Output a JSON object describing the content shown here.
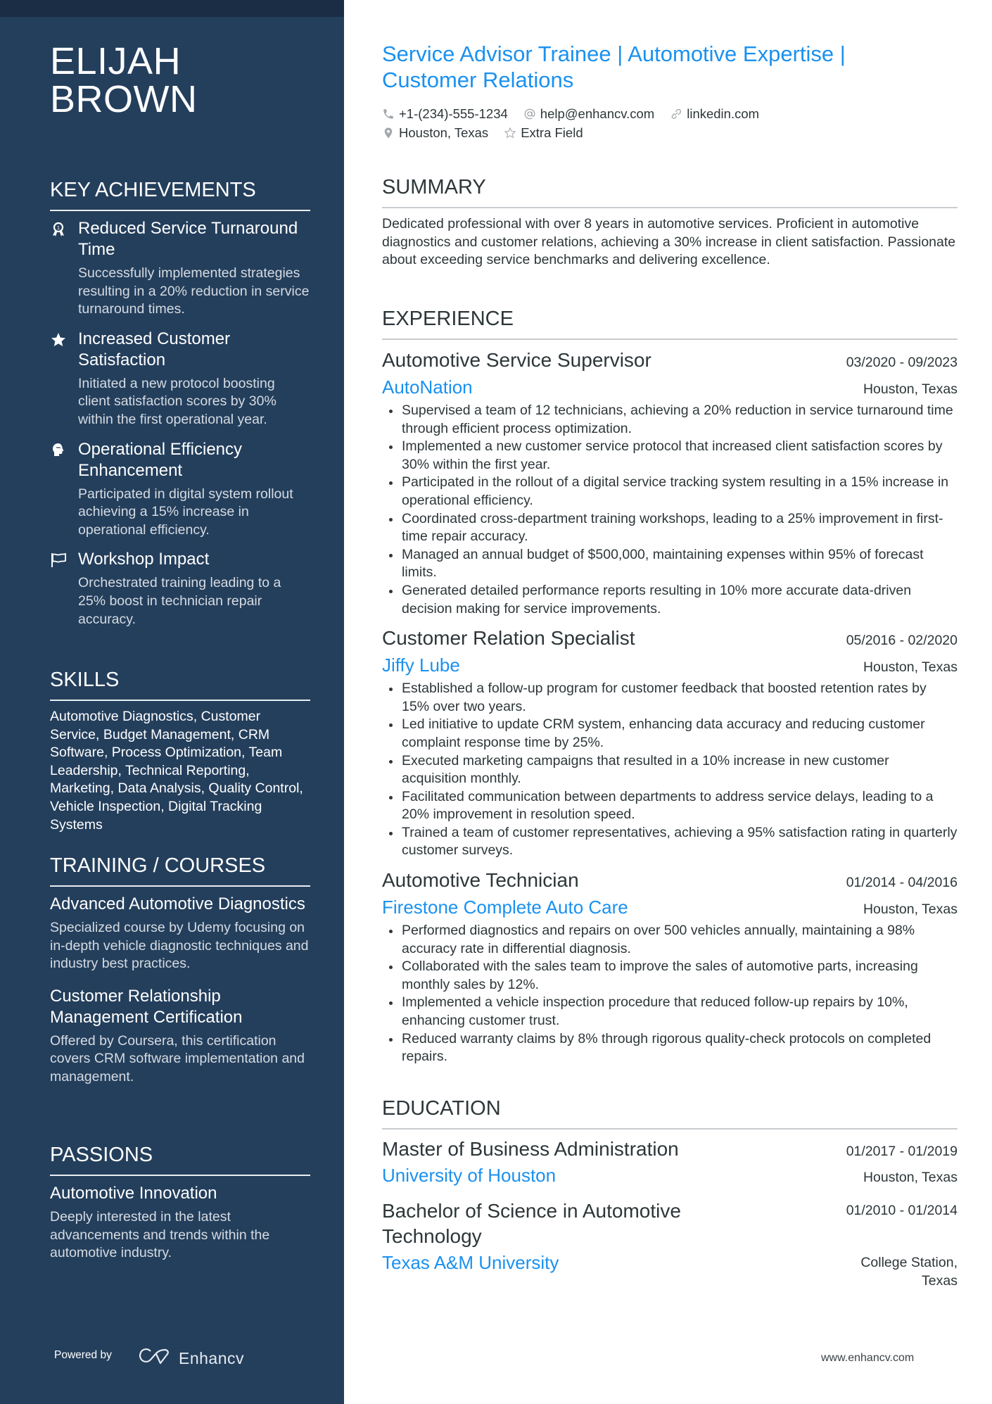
{
  "profile": {
    "first_name": "ELIJAH",
    "last_name": "BROWN",
    "headline": "Service Advisor Trainee | Automotive Expertise | Customer Relations",
    "contacts": {
      "phone": "+1-(234)-555-1234",
      "email": "help@enhancv.com",
      "linkedin": "linkedin.com",
      "location": "Houston, Texas",
      "extra": "Extra Field"
    }
  },
  "colors": {
    "sidebar": "#243f5c",
    "sidebar_strip": "#1b2d45",
    "accent": "#1a91f0",
    "text": "#2d3639"
  },
  "sidebar": {
    "achievements": {
      "heading": "KEY ACHIEVEMENTS",
      "items": [
        {
          "icon": "award-ribbon-icon",
          "title": "Reduced Service Turnaround Time",
          "desc": "Successfully implemented strategies resulting in a 20% reduction in service turnaround times."
        },
        {
          "icon": "star-icon",
          "title": "Increased Customer Satisfaction",
          "desc": "Initiated a new protocol boosting client satisfaction scores by 30% within the first operational year."
        },
        {
          "icon": "brain-head-icon",
          "title": "Operational Efficiency Enhancement",
          "desc": "Participated in digital system rollout achieving a 15% increase in operational efficiency."
        },
        {
          "icon": "flag-icon",
          "title": "Workshop Impact",
          "desc": "Orchestrated training leading to a 25% boost in technician repair accuracy."
        }
      ]
    },
    "skills": {
      "heading": "SKILLS",
      "text": "Automotive Diagnostics, Customer Service, Budget Management, CRM Software, Process Optimization, Team Leadership, Technical Reporting, Marketing, Data Analysis, Quality Control, Vehicle Inspection, Digital Tracking Systems"
    },
    "training": {
      "heading": "TRAINING / COURSES",
      "items": [
        {
          "title": "Advanced Automotive Diagnostics",
          "desc": "Specialized course by Udemy focusing on in-depth vehicle diagnostic techniques and industry best practices."
        },
        {
          "title": "Customer Relationship Management Certification",
          "desc": "Offered by Coursera, this certification covers CRM software implementation and management."
        }
      ]
    },
    "passions": {
      "heading": "PASSIONS",
      "items": [
        {
          "title": "Automotive Innovation",
          "desc": "Deeply interested in the latest advancements and trends within the automotive industry."
        }
      ]
    },
    "footer": {
      "powered_by": "Powered by",
      "brand": "Enhancv"
    }
  },
  "main": {
    "summary": {
      "heading": "SUMMARY",
      "text": "Dedicated professional with over 8 years in automotive services. Proficient in automotive diagnostics and customer relations, achieving a 30% increase in client satisfaction. Passionate about exceeding service benchmarks and delivering excellence."
    },
    "experience": {
      "heading": "EXPERIENCE",
      "jobs": [
        {
          "title": "Automotive Service Supervisor",
          "dates": "03/2020 - 09/2023",
          "company": "AutoNation",
          "location": "Houston, Texas",
          "bullets": [
            "Supervised a team of 12 technicians, achieving a 20% reduction in service turnaround time through efficient process optimization.",
            "Implemented a new customer service protocol that increased client satisfaction scores by 30% within the first year.",
            "Participated in the rollout of a digital service tracking system resulting in a 15% increase in operational efficiency.",
            "Coordinated cross-department training workshops, leading to a 25% improvement in first-time repair accuracy.",
            "Managed an annual budget of $500,000, maintaining expenses within 95% of forecast limits.",
            "Generated detailed performance reports resulting in 10% more accurate data-driven decision making for service improvements."
          ]
        },
        {
          "title": "Customer Relation Specialist",
          "dates": "05/2016 - 02/2020",
          "company": "Jiffy Lube",
          "location": "Houston, Texas",
          "bullets": [
            "Established a follow-up program for customer feedback that boosted retention rates by 15% over two years.",
            "Led initiative to update CRM system, enhancing data accuracy and reducing customer complaint response time by 25%.",
            "Executed marketing campaigns that resulted in a 10% increase in new customer acquisition monthly.",
            "Facilitated communication between departments to address service delays, leading to a 20% improvement in resolution speed.",
            "Trained a team of customer representatives, achieving a 95% satisfaction rating in quarterly customer surveys."
          ]
        },
        {
          "title": "Automotive Technician",
          "dates": "01/2014 - 04/2016",
          "company": "Firestone Complete Auto Care",
          "location": "Houston, Texas",
          "bullets": [
            "Performed diagnostics and repairs on over 500 vehicles annually, maintaining a 98% accuracy rate in differential diagnosis.",
            "Collaborated with the sales team to improve the sales of automotive parts, increasing monthly sales by 12%.",
            "Implemented a vehicle inspection procedure that reduced follow-up repairs by 10%, enhancing customer trust.",
            "Reduced warranty claims by 8% through rigorous quality-check protocols on completed repairs."
          ]
        }
      ]
    },
    "education": {
      "heading": "EDUCATION",
      "items": [
        {
          "degree": "Master of Business Administration",
          "dates": "01/2017 - 01/2019",
          "school": "University of Houston",
          "location": "Houston, Texas"
        },
        {
          "degree": "Bachelor of Science in Automotive Technology",
          "dates": "01/2010 - 01/2014",
          "school": "Texas A&M University",
          "location": "College Station, Texas"
        }
      ]
    },
    "footer_url": "www.enhancv.com"
  }
}
